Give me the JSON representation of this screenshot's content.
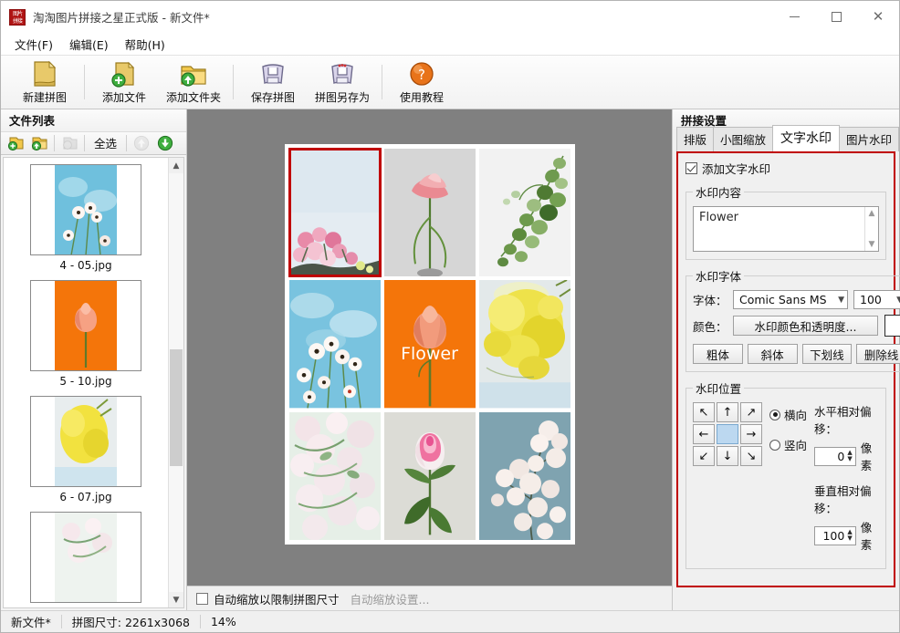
{
  "window": {
    "app_icon": "app-logo-icon",
    "title": "淘淘图片拼接之星正式版 - 新文件*",
    "minimize": "minimize-icon",
    "maximize": "maximize-icon",
    "close": "close-icon"
  },
  "menu": {
    "items": [
      {
        "label": "文件(F)"
      },
      {
        "label": "编辑(E)"
      },
      {
        "label": "帮助(H)"
      }
    ]
  },
  "toolbar": {
    "buttons": [
      {
        "label": "新建拼图",
        "icon": "new-collage-icon"
      },
      {
        "label": "添加文件",
        "icon": "add-file-icon"
      },
      {
        "label": "添加文件夹",
        "icon": "add-folder-icon"
      },
      {
        "label": "保存拼图",
        "icon": "save-collage-icon"
      },
      {
        "label": "拼图另存为",
        "icon": "save-as-icon"
      },
      {
        "label": "使用教程",
        "icon": "help-icon"
      }
    ]
  },
  "file_panel": {
    "header": "文件列表",
    "tools": [
      {
        "name": "add-file-icon",
        "label": ""
      },
      {
        "name": "add-folder-icon",
        "label": ""
      },
      {
        "name": "remove-file-icon",
        "label": ""
      },
      {
        "name": "select-all-button",
        "label": "全选"
      },
      {
        "name": "move-up-icon",
        "label": ""
      },
      {
        "name": "move-down-icon",
        "label": ""
      }
    ],
    "items": [
      {
        "name": "4 - 05.jpg"
      },
      {
        "name": "5 - 10.jpg"
      },
      {
        "name": "6 - 07.jpg"
      },
      {
        "name": ""
      }
    ]
  },
  "canvas": {
    "watermark_text": "Flower",
    "autoscale_label": "自动缩放以限制拼图尺寸",
    "autoscale_settings_link": "自动缩放设置...",
    "autoscale_checked": false
  },
  "settings": {
    "header": "拼接设置",
    "tabs": [
      {
        "label": "排版",
        "active": false
      },
      {
        "label": "小图缩放",
        "active": false
      },
      {
        "label": "文字水印",
        "active": true
      },
      {
        "label": "图片水印",
        "active": false
      }
    ],
    "enable_checkbox_label": "添加文字水印",
    "enable_checked": true,
    "content_group_title": "水印内容",
    "content_value": "Flower",
    "font_group_title": "水印字体",
    "font_label": "字体：",
    "font_value": "Comic Sans MS",
    "font_size_value": "100",
    "color_label": "颜色：",
    "color_button": "水印颜色和透明度...",
    "color_swatch": "#ffffff",
    "style_buttons": [
      {
        "label": "粗体"
      },
      {
        "label": "斜体"
      },
      {
        "label": "下划线"
      },
      {
        "label": "删除线"
      }
    ],
    "position_group_title": "水印位置",
    "position_cells": [
      {
        "name": "pos-top-left",
        "glyph": "↖"
      },
      {
        "name": "pos-top-center",
        "glyph": "↑"
      },
      {
        "name": "pos-top-right",
        "glyph": "↗"
      },
      {
        "name": "pos-middle-left",
        "glyph": "←"
      },
      {
        "name": "pos-center",
        "glyph": ""
      },
      {
        "name": "pos-middle-right",
        "glyph": "→"
      },
      {
        "name": "pos-bottom-left",
        "glyph": "↙"
      },
      {
        "name": "pos-bottom-center",
        "glyph": "↓"
      },
      {
        "name": "pos-bottom-right",
        "glyph": "↘"
      }
    ],
    "orientation": [
      {
        "label": "横向",
        "selected": true
      },
      {
        "label": "竖向",
        "selected": false
      }
    ],
    "h_offset_label": "水平相对偏移：",
    "h_offset_value": "0",
    "h_offset_unit": "像素",
    "v_offset_label": "垂直相对偏移：",
    "v_offset_value": "100",
    "v_offset_unit": "像素",
    "accent_color": "#c00000"
  },
  "status": {
    "file": "新文件*",
    "size": "拼图尺寸: 2261x3068",
    "zoom": "14%"
  }
}
